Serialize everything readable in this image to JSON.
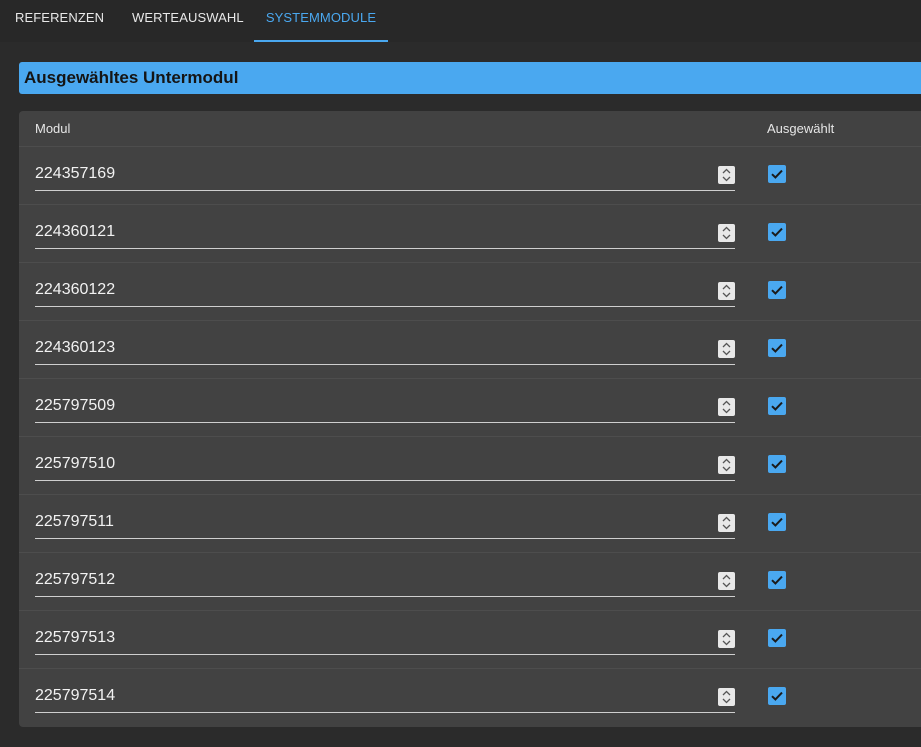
{
  "tabs": [
    {
      "label": "REFERENZEN",
      "active": false
    },
    {
      "label": "WERTEAUSWAHL",
      "active": false
    },
    {
      "label": "SYSTEMMODULE",
      "active": true
    }
  ],
  "section": {
    "title": "Ausgewähltes Untermodul"
  },
  "table": {
    "columns": {
      "modul": "Modul",
      "selected": "Ausgewählt"
    },
    "rows": [
      {
        "modul": "224357169",
        "selected": true
      },
      {
        "modul": "224360121",
        "selected": true
      },
      {
        "modul": "224360122",
        "selected": true
      },
      {
        "modul": "224360123",
        "selected": true
      },
      {
        "modul": "225797509",
        "selected": true
      },
      {
        "modul": "225797510",
        "selected": true
      },
      {
        "modul": "225797511",
        "selected": true
      },
      {
        "modul": "225797512",
        "selected": true
      },
      {
        "modul": "225797513",
        "selected": true
      },
      {
        "modul": "225797514",
        "selected": true
      }
    ]
  },
  "colors": {
    "accent": "#4aa8f0",
    "background": "#2b2b2b",
    "card": "#424242"
  },
  "icons": {
    "spinner": "up-down-spinner-icon",
    "checkbox": "check-icon"
  }
}
